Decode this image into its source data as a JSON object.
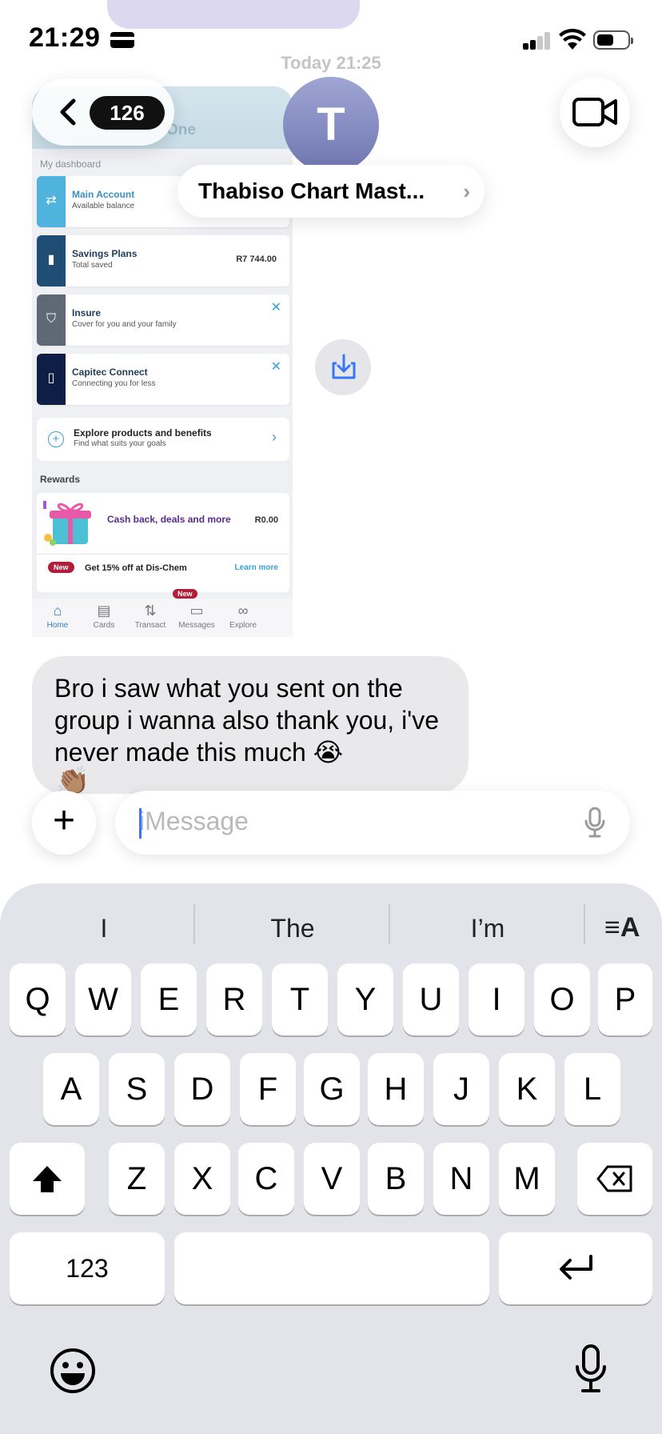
{
  "status_bar": {
    "time": "21:29"
  },
  "timestamp": "Today 21:25",
  "header": {
    "back_count": "126",
    "avatar_initial": "T",
    "contact_name": "Thabiso Chart Mast...",
    "name_chevron": "›"
  },
  "attachment": {
    "brand": "One",
    "dashboard_label": "My dashboard",
    "cards": [
      {
        "title": "Main Account",
        "subtitle": "Available balance",
        "value": "",
        "icon": "transfer-icon",
        "color": "#4fb3de"
      },
      {
        "title": "Savings Plans",
        "subtitle": "Total saved",
        "value": "R7 744.00",
        "icon": "bars-up-icon",
        "color": "#1f4d73"
      },
      {
        "title": "Insure",
        "subtitle": "Cover for you and your family",
        "value": "",
        "icon": "shield-icon",
        "color": "#5d6a76"
      },
      {
        "title": "Capitec Connect",
        "subtitle": "Connecting you for less",
        "value": "",
        "icon": "sim-icon",
        "color": "#0e1e44"
      }
    ],
    "explore": {
      "title": "Explore products and benefits",
      "subtitle": "Find what suits your goals"
    },
    "rewards_label": "Rewards",
    "reward": {
      "title": "Cash back, deals and more",
      "value": "R0.00"
    },
    "promo": {
      "badge": "New",
      "text": "Get 15% off at Dis-Chem",
      "link": "Learn more"
    },
    "nav": [
      {
        "label": "Home",
        "icon": "home-icon"
      },
      {
        "label": "Cards",
        "icon": "card-icon"
      },
      {
        "label": "Transact",
        "icon": "transact-icon"
      },
      {
        "label": "Messages",
        "icon": "messages-icon"
      },
      {
        "label": "Explore",
        "icon": "binoculars-icon"
      }
    ],
    "nav_badge": "New"
  },
  "message": {
    "text": "Bro i saw what you sent on the group i wanna also thank you, i've never made this much 😭",
    "trailing_emoji": "👏🏽"
  },
  "input": {
    "placeholder": "iMessage"
  },
  "keyboard": {
    "suggestions": [
      "I",
      "The",
      "I’m"
    ],
    "row1": [
      "Q",
      "W",
      "E",
      "R",
      "T",
      "Y",
      "U",
      "I",
      "O",
      "P"
    ],
    "row2": [
      "A",
      "S",
      "D",
      "F",
      "G",
      "H",
      "J",
      "K",
      "L"
    ],
    "row3": [
      "Z",
      "X",
      "C",
      "V",
      "B",
      "N",
      "M"
    ],
    "numbers_label": "123"
  }
}
